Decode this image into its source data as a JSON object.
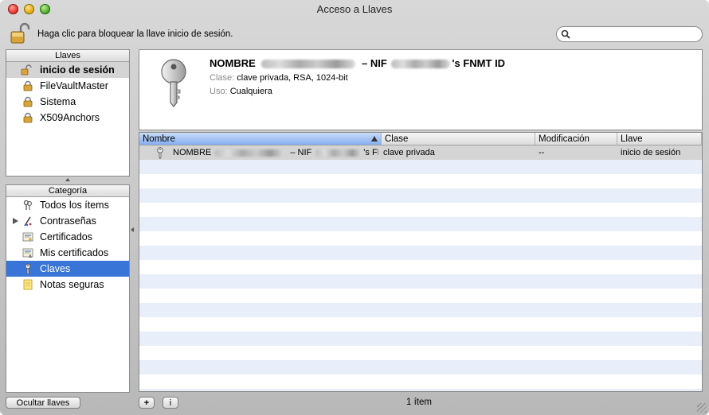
{
  "window": {
    "title": "Acceso a Llaves"
  },
  "toolbar": {
    "lock_hint": "Haga clic para bloquear la llave inicio de sesión."
  },
  "search": {
    "placeholder": ""
  },
  "keychains": {
    "header": "Llaves",
    "items": [
      {
        "label": "inicio de sesión",
        "icon": "unlocked-padlock-icon",
        "selected": true
      },
      {
        "label": "FileVaultMaster",
        "icon": "padlock-icon"
      },
      {
        "label": "Sistema",
        "icon": "padlock-icon"
      },
      {
        "label": "X509Anchors",
        "icon": "padlock-icon"
      }
    ]
  },
  "category": {
    "header": "Categoría",
    "items": [
      {
        "label": "Todos los ítems",
        "icon": "all-items-icon"
      },
      {
        "label": "Contraseñas",
        "icon": "passwords-icon",
        "expandable": true
      },
      {
        "label": "Certificados",
        "icon": "certificate-icon"
      },
      {
        "label": "Mis certificados",
        "icon": "my-certificate-icon"
      },
      {
        "label": "Claves",
        "icon": "key-icon",
        "selected": true
      },
      {
        "label": "Notas seguras",
        "icon": "secure-note-icon"
      }
    ]
  },
  "detail": {
    "name_prefix": "NOMBRE",
    "name_mid": " – NIF ",
    "name_suffix": "'s FNMT ID",
    "class_label": "Clase:",
    "class_value": "clave privada, RSA, 1024-bit",
    "use_label": "Uso:",
    "use_value": "Cualquiera"
  },
  "table": {
    "columns": [
      "Nombre",
      "Clase",
      "Modificación",
      "Llave"
    ],
    "sorted_column": "Nombre",
    "rows": [
      {
        "name_prefix": "NOMBRE",
        "name_mid": " – NIF ",
        "name_suffix": "'s FI",
        "clase": "clave privada",
        "modificacion": "--",
        "llave": "inicio de sesión"
      }
    ]
  },
  "footer": {
    "hide_button": "Ocultar llaves",
    "add_button": "+",
    "info_button": "i",
    "status": "1 ítem"
  }
}
